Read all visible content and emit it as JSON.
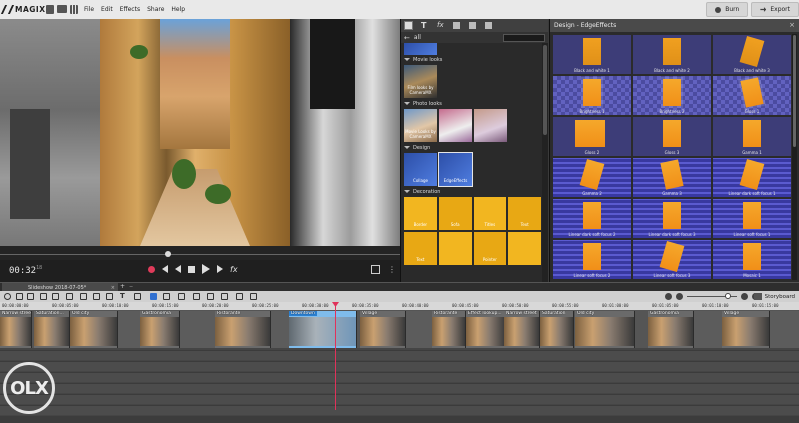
{
  "app": {
    "brand": "MAGIX",
    "menus": [
      "File",
      "Edit",
      "Effects",
      "Share",
      "Help"
    ],
    "burn_label": "Burn",
    "export_label": "Export"
  },
  "preview": {
    "timecode": "00:32",
    "timecode_frames": "18",
    "scrub_fraction": 0.42
  },
  "media_pool": {
    "breadcrumb": "all",
    "sections": [
      {
        "title": "Movie looks",
        "tiles": [
          "Film looks by CameraMX"
        ]
      },
      {
        "title": "Photo looks",
        "tiles": [
          "Movie Looks by CameraMX",
          "",
          ""
        ]
      },
      {
        "title": "Design",
        "tiles": [
          "Collage",
          "EdgeEffects"
        ]
      },
      {
        "title": "Decoration",
        "tiles": [
          "Border",
          "Sofa",
          "Titles",
          "Text",
          "Text",
          "",
          "Pointer",
          ""
        ]
      }
    ]
  },
  "design_panel": {
    "title": "Design - EdgeEffects",
    "cells": [
      "Black and white 1",
      "Black and white 2",
      "Black and white 3",
      "Brightness 1",
      "Brightness 2",
      "Gloss 1",
      "Gloss 2",
      "Gloss 3",
      "Gamma 1",
      "Gamma 2",
      "Gamma 3",
      "Linear dark soft focus 1",
      "Linear dark soft focus 2",
      "Linear dark soft focus 3",
      "Linear soft focus 1",
      "Linear soft focus 2",
      "Linear soft focus 3",
      "Mosaic 1"
    ]
  },
  "project": {
    "tab_label": "Slideshow 2018-07-05*",
    "add_label": "+",
    "arrow": "−"
  },
  "toolbar": {
    "storyboard_label": "Storyboard"
  },
  "timeline": {
    "ruler_marks": [
      "00:00:00:00",
      "00:00:05:00",
      "00:00:10:00",
      "00:00:15:00",
      "00:00:20:00",
      "00:00:25:00",
      "00:00:30:00",
      "00:00:35:00",
      "00:00:40:00",
      "00:00:45:00",
      "00:00:50:00",
      "00:00:55:00",
      "00:01:00:00",
      "00:01:05:00",
      "00:01:10:00",
      "00:01:15:00"
    ],
    "clips": [
      {
        "label": "Narrow street"
      },
      {
        "label": "Saturation..."
      },
      {
        "label": "Old city"
      },
      {
        "label": "Gastronomia"
      },
      {
        "label": "Ristorante"
      },
      {
        "label": "Downtown"
      },
      {
        "label": "Village"
      },
      {
        "label": "Ristorante"
      },
      {
        "label": "Effect lookup..."
      },
      {
        "label": "Narrow street"
      },
      {
        "label": "Saturation"
      },
      {
        "label": "Old city"
      },
      {
        "label": "Gastronomia"
      },
      {
        "label": "Village"
      }
    ]
  },
  "watermark": {
    "text": "OLX"
  }
}
